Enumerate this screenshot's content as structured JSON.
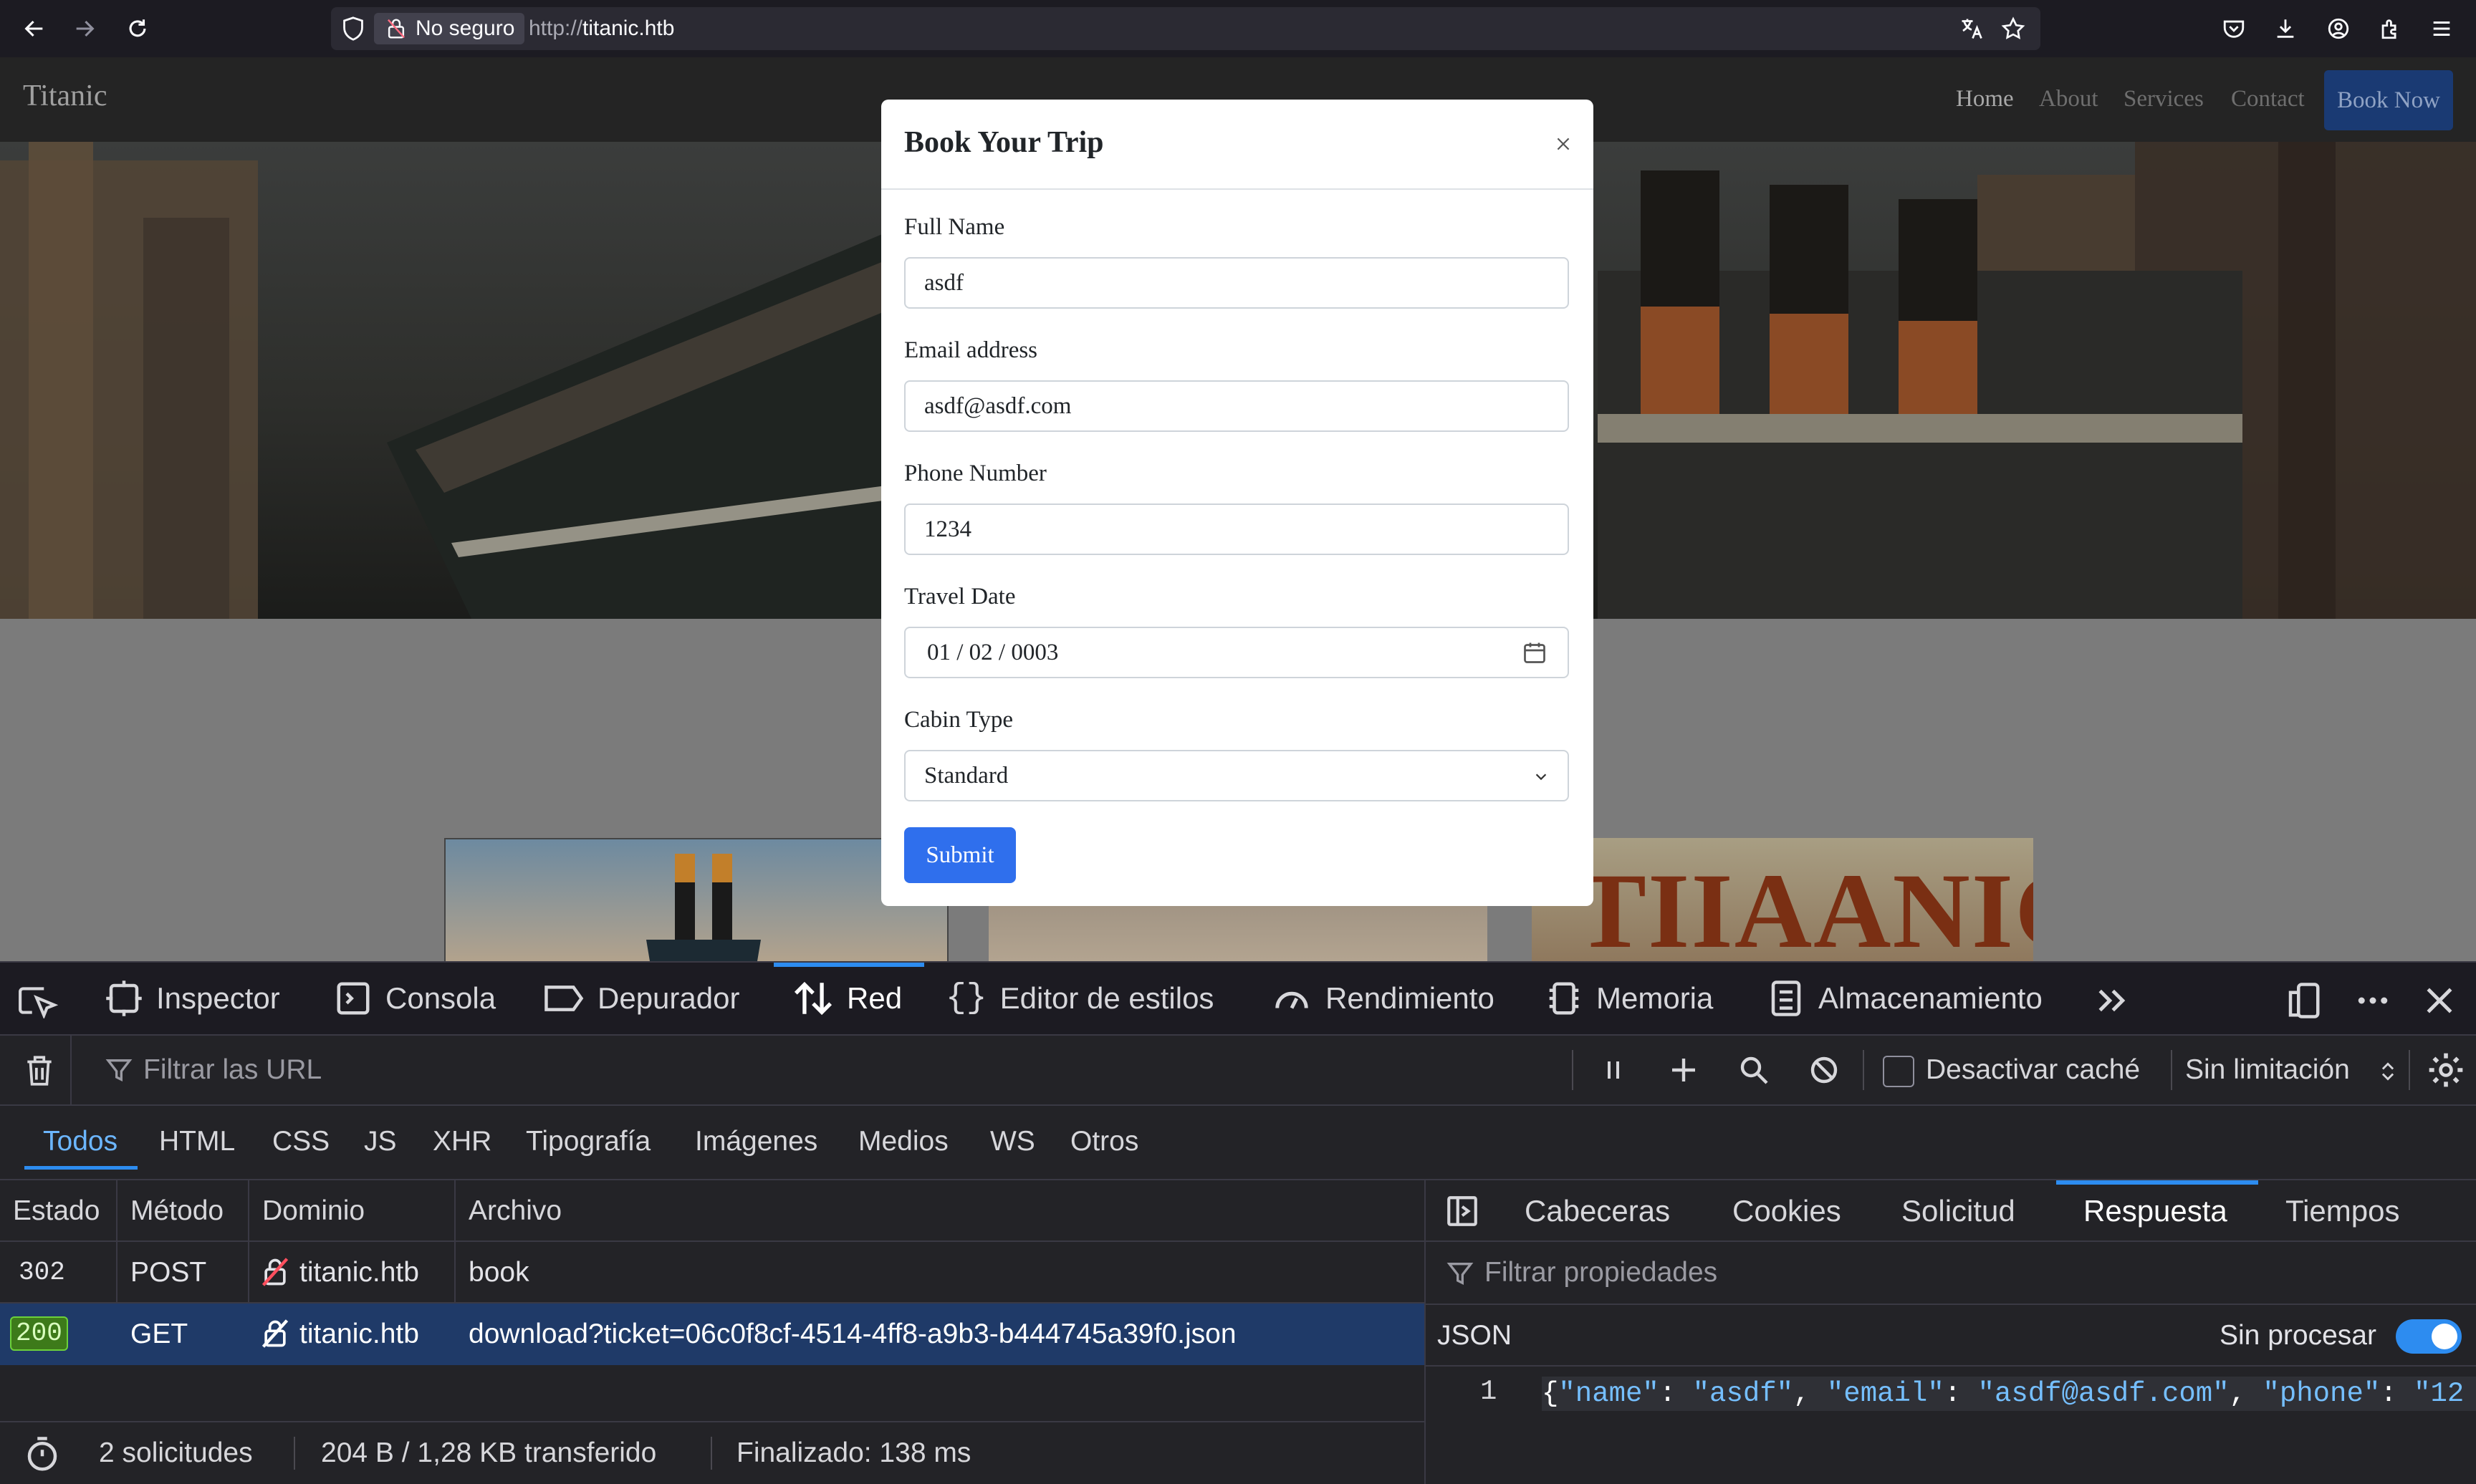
{
  "browser": {
    "security_label": "No seguro",
    "url_protocol": "http://",
    "url_host": "titanic.htb"
  },
  "site": {
    "brand": "Titanic",
    "nav": [
      "Home",
      "About",
      "Services",
      "Contact"
    ],
    "book_now": "Book Now",
    "gallery_poster_text": "TIIAANIC"
  },
  "modal": {
    "title": "Book Your Trip",
    "fields": {
      "full_name": {
        "label": "Full Name",
        "value": "asdf"
      },
      "email": {
        "label": "Email address",
        "value": "asdf@asdf.com"
      },
      "phone": {
        "label": "Phone Number",
        "value": "1234"
      },
      "travel_date": {
        "label": "Travel Date",
        "value": "01 / 02 / 0003"
      },
      "cabin": {
        "label": "Cabin Type",
        "value": "Standard"
      }
    },
    "submit": "Submit"
  },
  "devtools": {
    "tabs": [
      "Inspector",
      "Consola",
      "Depurador",
      "Red",
      "Editor de estilos",
      "Rendimiento",
      "Memoria",
      "Almacenamiento"
    ],
    "active_tab": "Red",
    "filter_placeholder": "Filtrar las URL",
    "disable_cache": "Desactivar caché",
    "throttling": "Sin limitación",
    "type_filters": [
      "Todos",
      "HTML",
      "CSS",
      "JS",
      "XHR",
      "Tipografía",
      "Imágenes",
      "Medios",
      "WS",
      "Otros"
    ],
    "columns": [
      "Estado",
      "Método",
      "Dominio",
      "Archivo"
    ],
    "requests": [
      {
        "status": "302",
        "method": "POST",
        "domain": "titanic.htb",
        "file": "book"
      },
      {
        "status": "200",
        "method": "GET",
        "domain": "titanic.htb",
        "file": "download?ticket=06c0f8cf-4514-4ff8-a9b3-b444745a39f0.json"
      }
    ],
    "status_bar": {
      "requests": "2 solicitudes",
      "transferred": "204 B / 1,28 KB transferido",
      "finished": "Finalizado: 138 ms"
    },
    "details": {
      "tabs": [
        "Cabeceras",
        "Cookies",
        "Solicitud",
        "Respuesta",
        "Tiempos"
      ],
      "active_tab": "Respuesta",
      "filter_placeholder": "Filtrar propiedades",
      "json_label": "JSON",
      "raw_label": "Sin procesar",
      "line_number": "1",
      "code": {
        "k1": "\"name\"",
        "v1": "\"asdf\"",
        "k2": "\"email\"",
        "v2": "\"asdf@asdf.com\"",
        "k3": "\"phone\"",
        "v3": "\"12"
      }
    }
  },
  "colors": {
    "accent": "#2d8cf0",
    "submit": "#2f6fed",
    "book_now": "#1a3a73",
    "status_ok": "#3d7a1a",
    "selected_row": "#1f3a68"
  }
}
